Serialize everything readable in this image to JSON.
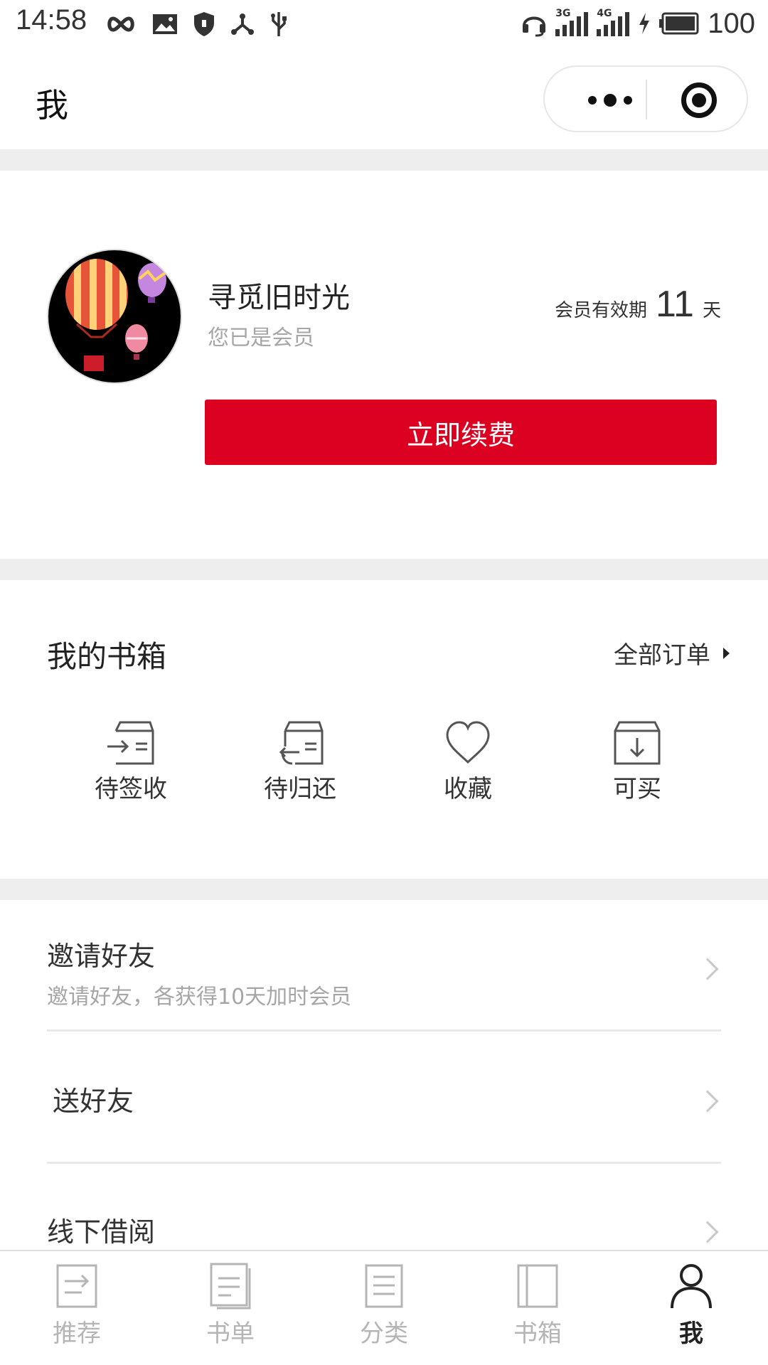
{
  "status_bar": {
    "time": "14:58",
    "battery": "100",
    "icons": [
      "infinity-icon",
      "image-icon",
      "shield-icon",
      "network-icon",
      "usb-icon",
      "headset-icon",
      "signal-3g-icon",
      "signal-4g-icon",
      "charging-icon",
      "battery-icon"
    ],
    "signal_labels": [
      "3G",
      "4G"
    ]
  },
  "nav": {
    "title": "我",
    "capsule_icons": [
      "more-dots-icon",
      "close-target-icon"
    ]
  },
  "profile": {
    "username": "寻觅旧时光",
    "member_status": "您已是会员",
    "validity_label": "会员有效期",
    "validity_days": "11",
    "validity_unit": "天",
    "renew_button": "立即续费",
    "avatar_icon": "hot-air-balloon-avatar"
  },
  "bookcase": {
    "title": "我的书箱",
    "all_orders": "全部订单",
    "items": [
      {
        "label": "待签收",
        "icon": "box-inbound-icon"
      },
      {
        "label": "待归还",
        "icon": "box-return-icon"
      },
      {
        "label": "收藏",
        "icon": "heart-icon"
      },
      {
        "label": "可买",
        "icon": "box-download-icon"
      }
    ]
  },
  "menu": [
    {
      "title": "邀请好友",
      "subtitle": "邀请好友，各获得10天加时会员"
    },
    {
      "title": "送好友",
      "subtitle": ""
    },
    {
      "title": "线下借阅",
      "subtitle": ""
    }
  ],
  "tabbar": {
    "active": "我",
    "tabs": [
      {
        "label": "推荐",
        "icon": "recommend-icon"
      },
      {
        "label": "书单",
        "icon": "booklist-icon"
      },
      {
        "label": "分类",
        "icon": "category-icon"
      },
      {
        "label": "书箱",
        "icon": "bookcase-icon"
      },
      {
        "label": "我",
        "icon": "person-icon"
      }
    ]
  },
  "colors": {
    "accent": "#dc0021",
    "separator": "#eeeeee",
    "muted_text": "#a6a6a6",
    "tab_inactive": "#b5b5b5"
  }
}
